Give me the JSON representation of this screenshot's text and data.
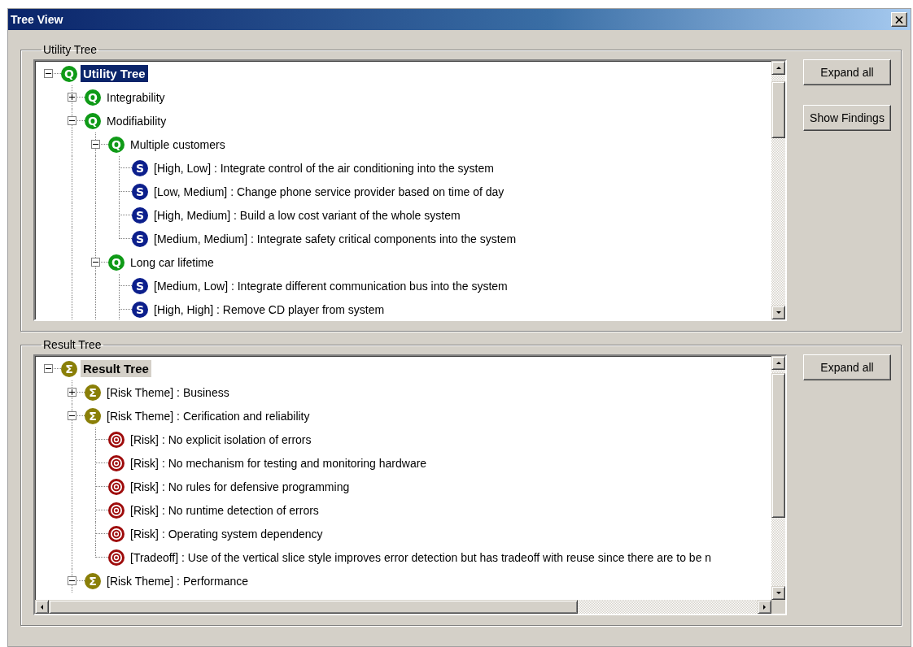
{
  "window": {
    "title": "Tree View"
  },
  "panels": [
    {
      "label": "Utility Tree",
      "focused": true,
      "continues_below": true,
      "horizontal_scroll": false,
      "buttons": [
        "Expand all",
        "Show Findings"
      ],
      "nodes": [
        {
          "kind": "quality",
          "glyph": "Q",
          "label": "Utility Tree",
          "selected": true,
          "expanded": true,
          "children": [
            {
              "kind": "quality",
              "glyph": "Q",
              "label": "Integrability",
              "selected": false,
              "expanded": false
            },
            {
              "kind": "quality",
              "glyph": "Q",
              "label": "Modifiability",
              "selected": false,
              "expanded": true,
              "children": [
                {
                  "kind": "quality",
                  "glyph": "Q",
                  "label": "Multiple customers",
                  "selected": false,
                  "expanded": true,
                  "children": [
                    {
                      "kind": "scenario",
                      "glyph": "S",
                      "label": "[High, Low] : Integrate control of the air conditioning into the system",
                      "selected": false
                    },
                    {
                      "kind": "scenario",
                      "glyph": "S",
                      "label": "[Low, Medium] : Change phone service provider based on time of day",
                      "selected": false
                    },
                    {
                      "kind": "scenario",
                      "glyph": "S",
                      "label": "[High, Medium] : Build a low cost variant of the whole system",
                      "selected": false
                    },
                    {
                      "kind": "scenario",
                      "glyph": "S",
                      "label": "[Medium, Medium] : Integrate safety critical components into the system",
                      "selected": false
                    }
                  ]
                },
                {
                  "kind": "quality",
                  "glyph": "Q",
                  "label": "Long car lifetime",
                  "selected": false,
                  "expanded": true,
                  "children": [
                    {
                      "kind": "scenario",
                      "glyph": "S",
                      "label": "[Medium, Low] : Integrate different communication bus into the system",
                      "selected": false
                    },
                    {
                      "kind": "scenario",
                      "glyph": "S",
                      "label": "[High, High] : Remove CD player from system",
                      "selected": false
                    }
                  ]
                }
              ]
            }
          ]
        }
      ]
    },
    {
      "label": "Result Tree",
      "focused": false,
      "continues_below": true,
      "horizontal_scroll": true,
      "buttons": [
        "Expand all"
      ],
      "nodes": [
        {
          "kind": "theme",
          "glyph": "Σ",
          "label": "Result Tree",
          "selected": true,
          "expanded": true,
          "children": [
            {
              "kind": "theme",
              "glyph": "Σ",
              "label": "[Risk Theme] : Business",
              "selected": false,
              "expanded": false
            },
            {
              "kind": "theme",
              "glyph": "Σ",
              "label": "[Risk Theme] : Cerification and reliability",
              "selected": false,
              "expanded": true,
              "children": [
                {
                  "kind": "risk",
                  "label": "[Risk] : No explicit isolation of errors",
                  "selected": false
                },
                {
                  "kind": "risk",
                  "label": "[Risk] : No mechanism for testing and monitoring hardware",
                  "selected": false
                },
                {
                  "kind": "risk",
                  "label": "[Risk] : No rules for defensive programming",
                  "selected": false
                },
                {
                  "kind": "risk",
                  "label": "[Risk] : No runtime detection of errors",
                  "selected": false
                },
                {
                  "kind": "risk",
                  "label": "[Risk] : Operating system dependency",
                  "selected": false
                },
                {
                  "kind": "risk",
                  "label": "[Tradeoff] : Use of the vertical slice style improves error detection but has tradeoff with reuse since there are to be n",
                  "selected": false
                }
              ]
            },
            {
              "kind": "theme",
              "glyph": "Σ",
              "label": "[Risk Theme] : Performance",
              "selected": false,
              "expanded": true
            }
          ]
        }
      ]
    }
  ]
}
